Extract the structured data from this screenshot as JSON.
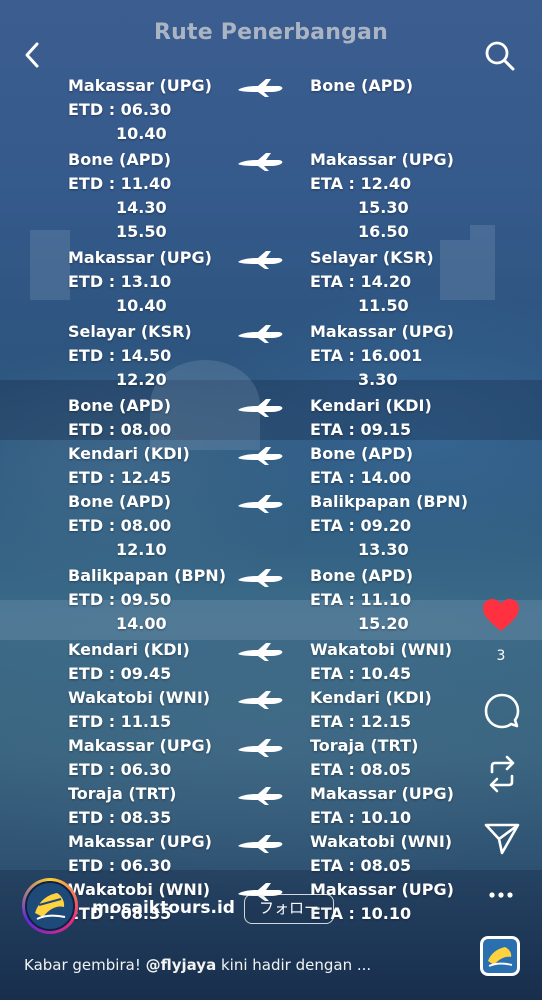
{
  "header": {
    "title": "Rute Penerbangan"
  },
  "icons": {
    "back": "chevron-left-icon",
    "search": "search-icon"
  },
  "routes": [
    {
      "from": "Makassar (UPG)",
      "to": "Bone (APD)",
      "left": [
        "ETD : 06.30",
        "10.40"
      ],
      "right": []
    },
    {
      "from": "Bone (APD)",
      "to": "Makassar (UPG)",
      "left": [
        "ETD : 11.40",
        "14.30",
        "15.50"
      ],
      "right": [
        "ETA : 12.40",
        "15.30",
        "16.50"
      ]
    },
    {
      "from": "Makassar (UPG)",
      "to": "Selayar (KSR)",
      "left": [
        "ETD : 13.10",
        "10.40"
      ],
      "right": [
        "ETA : 14.20",
        "11.50"
      ]
    },
    {
      "from": "Selayar (KSR)",
      "to": "Makassar (UPG)",
      "left": [
        "ETD : 14.50",
        "12.20"
      ],
      "right": [
        "ETA : 16.001",
        "3.30"
      ]
    },
    {
      "from": "Bone (APD)",
      "to": "Kendari (KDI)",
      "left": [
        "ETD : 08.00"
      ],
      "right": [
        "ETA : 09.15"
      ]
    },
    {
      "from": "Kendari (KDI)",
      "to": "Bone (APD)",
      "left": [
        "ETD : 12.45"
      ],
      "right": [
        "ETA : 14.00"
      ]
    },
    {
      "from": "Bone (APD)",
      "to": "Balikpapan (BPN)",
      "left": [
        "ETD : 08.00",
        "12.10"
      ],
      "right": [
        "ETA : 09.20",
        "13.30"
      ]
    },
    {
      "from": "Balikpapan (BPN)",
      "to": "Bone (APD)",
      "left": [
        "ETD : 09.50",
        "14.00"
      ],
      "right": [
        "ETA : 11.10",
        "15.20"
      ]
    },
    {
      "from": "Kendari (KDI)",
      "to": "Wakatobi (WNI)",
      "left": [
        "ETD : 09.45"
      ],
      "right": [
        "ETA : 10.45"
      ]
    },
    {
      "from": "Wakatobi (WNI)",
      "to": "Kendari (KDI)",
      "left": [
        "ETD : 11.15"
      ],
      "right": [
        "ETA : 12.15"
      ]
    },
    {
      "from": "Makassar (UPG)",
      "to": "Toraja (TRT)",
      "left": [
        "ETD : 06.30"
      ],
      "right": [
        "ETA : 08.05"
      ]
    },
    {
      "from": "Toraja (TRT)",
      "to": "Makassar (UPG)",
      "left": [
        "ETD : 08.35"
      ],
      "right": [
        "ETA : 10.10"
      ]
    },
    {
      "from": "Makassar (UPG)",
      "to": "Wakatobi (WNI)",
      "left": [
        "ETD : 06.30"
      ],
      "right": [
        "ETA : 08.05"
      ]
    },
    {
      "from": "Wakatobi (WNI)",
      "to": "Makassar (UPG)",
      "left": [
        "ETD : 08.35"
      ],
      "right": [
        "ETA : 10.10"
      ]
    }
  ],
  "actions": {
    "likes": "3"
  },
  "account": {
    "name": "mosaiktours.id",
    "follow_label": "フォロー"
  },
  "caption": {
    "prefix": "Kabar gembira! ",
    "mention": "@flyjaya",
    "suffix": " kini hadir dengan ..."
  },
  "colors": {
    "heart": "#ff3040",
    "text": "#ffffff",
    "title": "#bfc3cc"
  }
}
